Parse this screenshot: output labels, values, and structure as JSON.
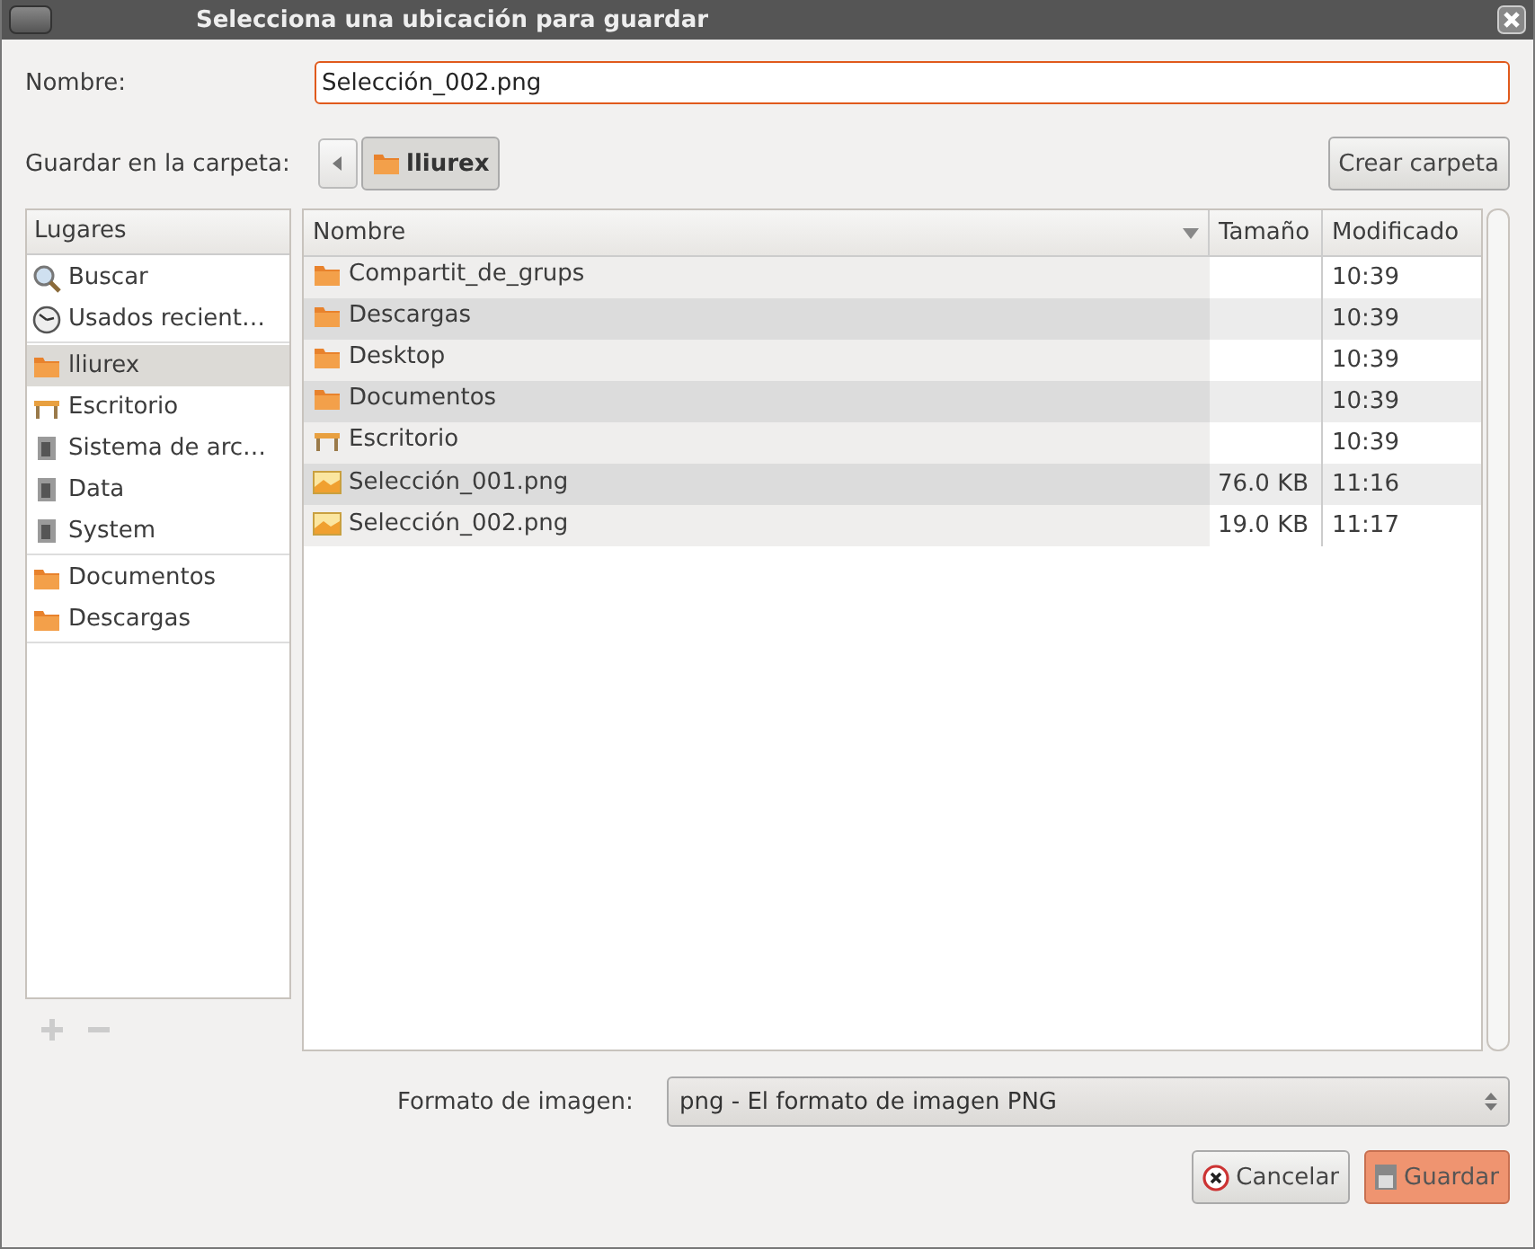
{
  "window": {
    "title": "Selecciona una ubicación para guardar"
  },
  "name_field": {
    "label": "Nombre:",
    "value": "Selección_002.png"
  },
  "folder_path": {
    "label": "Guardar en la carpeta:",
    "segments": [
      {
        "label": "lliurex",
        "selected": true
      }
    ],
    "create_button": "Crear carpeta"
  },
  "places": {
    "header": "Lugares",
    "groups": [
      [
        {
          "label": "Buscar",
          "kind": "search",
          "selected": false
        },
        {
          "label": "Usados recient…",
          "kind": "recent",
          "selected": false
        }
      ],
      [
        {
          "label": "lliurex",
          "kind": "home",
          "selected": true
        },
        {
          "label": "Escritorio",
          "kind": "desk",
          "selected": false
        },
        {
          "label": "Sistema de arc…",
          "kind": "drive",
          "selected": false
        },
        {
          "label": "Data",
          "kind": "drive",
          "selected": false
        },
        {
          "label": "System",
          "kind": "drive",
          "selected": false
        }
      ],
      [
        {
          "label": "Documentos",
          "kind": "folder",
          "selected": false
        },
        {
          "label": "Descargas",
          "kind": "folder",
          "selected": false
        }
      ]
    ]
  },
  "files": {
    "columns": [
      "Nombre",
      "Tamaño",
      "Modificado"
    ],
    "rows": [
      {
        "name": "Compartit_de_grups",
        "kind": "folder",
        "size": "",
        "modified": "10:39"
      },
      {
        "name": "Descargas",
        "kind": "folder",
        "size": "",
        "modified": "10:39"
      },
      {
        "name": "Desktop",
        "kind": "folder",
        "size": "",
        "modified": "10:39"
      },
      {
        "name": "Documentos",
        "kind": "folder",
        "size": "",
        "modified": "10:39"
      },
      {
        "name": "Escritorio",
        "kind": "desk",
        "size": "",
        "modified": "10:39"
      },
      {
        "name": "Selección_001.png",
        "kind": "image",
        "size": "76.0 KB",
        "modified": "11:16"
      },
      {
        "name": "Selección_002.png",
        "kind": "image",
        "size": "19.0 KB",
        "modified": "11:17"
      }
    ]
  },
  "format": {
    "label": "Formato de imagen:",
    "value": "png - El formato de imagen PNG"
  },
  "buttons": [
    {
      "label": "Cancelar",
      "kind": "cancel"
    },
    {
      "label": "Guardar",
      "kind": "save"
    }
  ]
}
